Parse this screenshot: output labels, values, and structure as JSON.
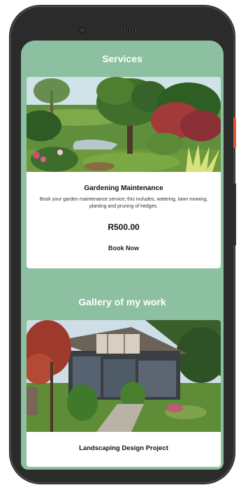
{
  "services": {
    "heading": "Services",
    "card": {
      "image_icon": "garden-photo",
      "title": "Gardening Maintenance",
      "description": "Book your garden maintenance service; this includes, watering, lawn mowing, planting and pruning of hedges.",
      "price": "R500.00",
      "cta": "Book Now"
    }
  },
  "gallery": {
    "heading": "Gallery of my work",
    "items": [
      {
        "image_icon": "house-landscape-photo",
        "title": "Landscaping Design Project"
      }
    ]
  },
  "colors": {
    "screen_bg": "#8cc0a0",
    "card_bg": "#ffffff",
    "phone_frame": "#2b2b2b",
    "power_button": "#e4552f"
  }
}
